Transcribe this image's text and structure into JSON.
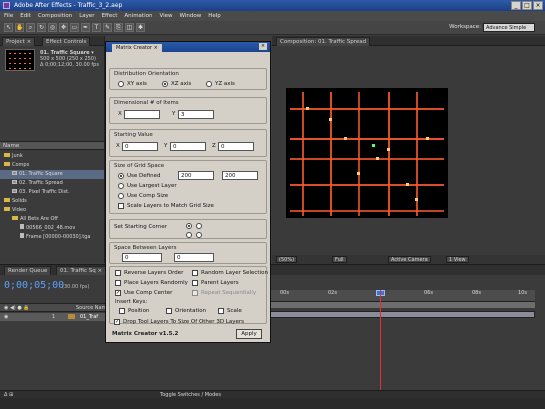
{
  "app": {
    "title": "Adobe After Effects - Traffic_3_2.aep",
    "menu": [
      "File",
      "Edit",
      "Composition",
      "Layer",
      "Effect",
      "Animation",
      "View",
      "Window",
      "Help"
    ],
    "workspace_label": "Workspace:",
    "workspace_value": "Advance Simple",
    "window_buttons": [
      "_",
      "□",
      "×"
    ]
  },
  "project": {
    "tabs": [
      "Project ×",
      "Effect Controls"
    ],
    "selected_name": "01. Traffic Square ▾",
    "info": [
      "500 x 500 (250 x 250)",
      "Δ 0;00;12;00, 30.00 fps"
    ],
    "name_header": "Name",
    "tree": [
      {
        "label": "Junk",
        "type": "folder",
        "indent": 1
      },
      {
        "label": "Comps",
        "type": "folder",
        "indent": 1
      },
      {
        "label": "01. Traffic Square",
        "type": "comp",
        "indent": 2,
        "selected": true
      },
      {
        "label": "02. Traffic Spread",
        "type": "comp",
        "indent": 2
      },
      {
        "label": "03. Pixel Traffic Dist.",
        "type": "comp",
        "indent": 2
      },
      {
        "label": "Solids",
        "type": "folder",
        "indent": 1
      },
      {
        "label": "Video",
        "type": "folder",
        "indent": 1
      },
      {
        "label": "All Bets Are Off",
        "type": "folder",
        "indent": 2
      },
      {
        "label": "00566_002_48.mov",
        "type": "file",
        "indent": 3
      },
      {
        "label": "Frame [00000-00030].tga",
        "type": "file",
        "indent": 3
      }
    ]
  },
  "dialog": {
    "tab": "Matrix Creator ×",
    "close": "×",
    "distribution": {
      "label": "Distribution Orientation",
      "options": [
        "XY axis",
        "XZ axis",
        "YZ axis"
      ],
      "selected": 1
    },
    "dimensional": {
      "label": "Dimensional # of Items",
      "x_label": "X",
      "x_value": "",
      "y_label": "Y",
      "y_value": "3"
    },
    "starting_value": {
      "label": "Starting Value",
      "x_label": "X",
      "x_value": "0",
      "y_label": "Y",
      "y_value": "0",
      "z_label": "Z",
      "z_value": "0"
    },
    "size": {
      "label": "Size of Grid Space",
      "options": [
        "Use Defined",
        "Use Largest Layer",
        "Use Comp Size",
        "Scale Layers to Match Grid Size"
      ],
      "selected": 0,
      "w_value": "200",
      "h_value": "200"
    },
    "starting_corner_label": "Set Starting Corner",
    "spacing": {
      "label": "Space Between Layers",
      "x_value": "0",
      "y_value": "0"
    },
    "checks": [
      {
        "label": "Reverse Layers Order",
        "checked": false
      },
      {
        "label": "Random Layer Selection",
        "checked": false
      },
      {
        "label": "Place Layers Randomly",
        "checked": false
      },
      {
        "label": "Parent Layers",
        "checked": false
      },
      {
        "label": "Use Comp Center",
        "checked": true
      },
      {
        "label": "Repeat Sequentially",
        "checked": false
      }
    ],
    "insert_keys": {
      "label": "Insert Keys:",
      "options": [
        "Position",
        "Orientation",
        "Scale"
      ]
    },
    "drop_tool": "Drop Tool Layers To Size Of Other 3D Layers",
    "apply": "Apply",
    "footer": "Matrix Creator v1.5.2"
  },
  "composition": {
    "tab": "Composition: 01. Traffic Spread",
    "view_controls": [
      "(50%)",
      "Full",
      "Active Camera",
      "1 View"
    ]
  },
  "timeline": {
    "tabs": [
      "Render Queue",
      "01. Traffic Sq ×"
    ],
    "timecode": "0;00;05;00",
    "fps": "(30.00 fps)",
    "column_header": "Source Name",
    "layer_index": "1",
    "layer_name": "01_Traf",
    "ruler_ticks": [
      "00s",
      "02s",
      "04s",
      "06s",
      "08s",
      "10s"
    ],
    "footer_left": "Δ  ⊞",
    "footer_center": "Toggle Switches / Modes"
  }
}
